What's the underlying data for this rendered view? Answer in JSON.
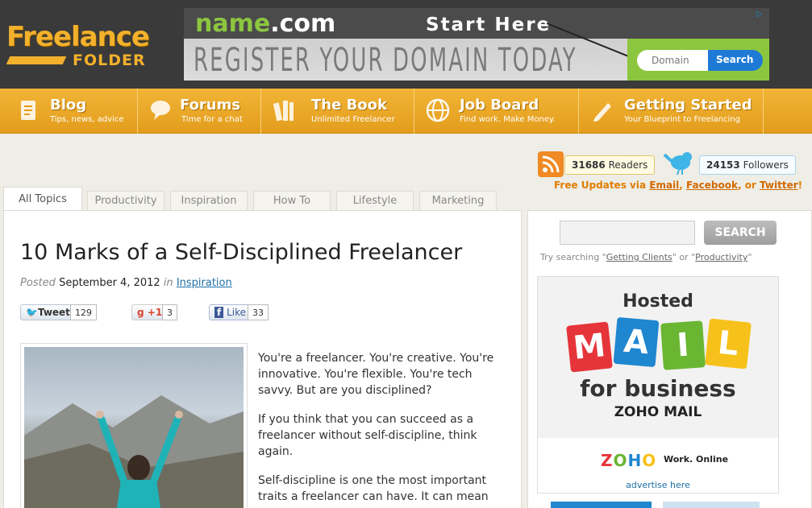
{
  "logo": {
    "word1": "Freelance",
    "word2": "FOLDER"
  },
  "ad_banner": {
    "brand": "name",
    "brand_dot": ".com",
    "headline": "Start Here",
    "tagline": "REGISTER YOUR DOMAIN TODAY",
    "input_placeholder": "Domain",
    "button": "Search"
  },
  "nav": [
    {
      "title": "Blog",
      "sub": "Tips, news, advice",
      "icon": "document-icon"
    },
    {
      "title": "Forums",
      "sub": "Time for a chat",
      "icon": "speech-bubbles-icon"
    },
    {
      "title": "The Book",
      "sub": "Unlimited Freelancer",
      "icon": "books-icon"
    },
    {
      "title": "Job Board",
      "sub": "Find work. Make Money.",
      "icon": "globe-icon"
    },
    {
      "title": "Getting Started",
      "sub": "Your Blueprint to Freelancing",
      "icon": "pencil-icon"
    }
  ],
  "social": {
    "readers_count": "31686",
    "readers_label": "Readers",
    "followers_count": "24153",
    "followers_label": "Followers",
    "updates_prefix": "Free Updates via",
    "email": "Email",
    "facebook": "Facebook",
    "or": "or",
    "twitter": "Twitter"
  },
  "tabs": [
    "All Topics",
    "Productivity",
    "Inspiration",
    "How To",
    "Lifestyle",
    "Marketing"
  ],
  "post": {
    "title": "10 Marks of a Self-Disciplined Freelancer",
    "posted_label": "Posted",
    "date": "September 4, 2012",
    "in_label": "in",
    "category": "Inspiration",
    "tweet_label": "Tweet",
    "tweet_count": "129",
    "plus_label": "+1",
    "plus_count": "3",
    "like_label": "Like",
    "like_count": "33",
    "paragraphs": [
      "You're a freelancer. You're creative. You're innovative. You're flexible. You're tech savvy. But are you disciplined?",
      "If you think that you can succeed as a freelancer without self-discipline, think again.",
      "Self-discipline is one the most important traits a freelancer can have. It can mean"
    ]
  },
  "sidebar": {
    "search_button": "SEARCH",
    "try_prefix": "Try searching \"",
    "try_1": "Getting Clients",
    "try_mid": "\" or \"",
    "try_2": "Productivity",
    "try_suffix": "\"",
    "ad": {
      "hosted": "Hosted",
      "letters": [
        "M",
        "A",
        "I",
        "L"
      ],
      "for_business": "for business",
      "product": "ZOHO MAIL",
      "zoho_logo": "ZOHO",
      "zoho_tag": "Work. Online",
      "advertise": "advertise here"
    }
  },
  "colors": {
    "nav_orange": "#e9a62a",
    "link_blue": "#1f6fa6",
    "updates_orange": "#e07d00"
  }
}
